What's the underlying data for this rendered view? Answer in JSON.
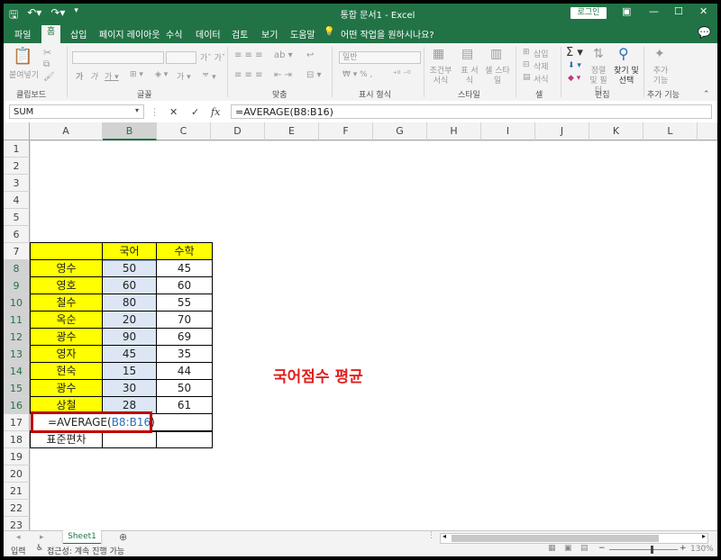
{
  "titlebar": {
    "doc_title": "통합 문서1  -  Excel",
    "login_label": "로그인"
  },
  "tabs": [
    "파일",
    "홈",
    "삽입",
    "페이지 레이아웃",
    "수식",
    "데이터",
    "검토",
    "보기",
    "도움말"
  ],
  "tell_me": "어떤 작업을 원하시나요?",
  "ribbon": {
    "paste": "붙여넣기",
    "clipboard": "클립보드",
    "font": "글꼴",
    "alignment": "맞춤",
    "number_format_value": "일반",
    "number": "표시 형식",
    "cond_format": "조건부 서식",
    "table_format": "표 서식",
    "cell_style": "셀 스타일",
    "styles": "스타일",
    "insert": "삽입",
    "delete": "삭제",
    "format": "서식",
    "cells": "셀",
    "sort_filter": "정렬 및 필터",
    "find_select": "찾기 및 선택",
    "editing": "편집",
    "addins": "추가 기능",
    "addins_group": "추가 기능"
  },
  "formula_bar": {
    "name_box": "SUM",
    "formula": "=AVERAGE(B8:B16)"
  },
  "columns": [
    "A",
    "B",
    "C",
    "D",
    "E",
    "F",
    "G",
    "H",
    "I",
    "J",
    "K",
    "L"
  ],
  "rows": [
    "1",
    "2",
    "3",
    "4",
    "5",
    "6",
    "7",
    "8",
    "9",
    "10",
    "11",
    "12",
    "13",
    "14",
    "15",
    "16",
    "17",
    "18",
    "19",
    "20",
    "21",
    "22",
    "23"
  ],
  "table": {
    "header": [
      "",
      "국어",
      "수학"
    ],
    "rows": [
      [
        "영수",
        "50",
        "45"
      ],
      [
        "영호",
        "60",
        "60"
      ],
      [
        "철수",
        "80",
        "55"
      ],
      [
        "옥순",
        "20",
        "70"
      ],
      [
        "광수",
        "90",
        "69"
      ],
      [
        "영자",
        "45",
        "35"
      ],
      [
        "현숙",
        "15",
        "44"
      ],
      [
        "광수",
        "30",
        "50"
      ],
      [
        "상철",
        "28",
        "61"
      ]
    ],
    "editing_formula": "=AVERAGE(",
    "editing_ref": "B8:B16",
    "editing_close": ")",
    "row18_label": "표준편차"
  },
  "annotation": "국어점수 평균",
  "sheet_tab": "Sheet1",
  "status": {
    "mode": "입력",
    "accessibility": "접근성: 계속 진행 가능",
    "zoom": "130%"
  },
  "colors": {
    "excel_green": "#217346",
    "yellow": "#ffff00",
    "selection": "#dce6f4",
    "annotation_red": "#e0201f",
    "box_red": "#c00000"
  }
}
